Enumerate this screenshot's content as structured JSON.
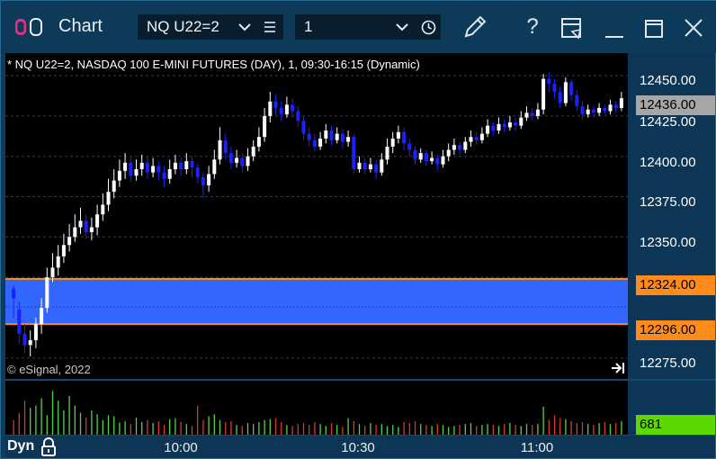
{
  "window": {
    "title": "Chart",
    "symbol_value": "NQ U22=2",
    "interval_value": "1",
    "icons": [
      "app-toggle-icon",
      "chevron-down-icon",
      "list-icon",
      "chevron-down-icon",
      "clock-icon",
      "pencil-icon",
      "help-icon",
      "form-icon",
      "minimize-icon",
      "maximize-icon",
      "close-icon"
    ],
    "help_label": "?"
  },
  "chart": {
    "title": "* NQ U22=2, NASDAQ 100 E-MINI FUTURES (DAY), 1, 09:30-16:15 (Dynamic)",
    "copyright": "© eSignal, 2022",
    "price_labels": [
      "12450.00",
      "12425.00",
      "12400.00",
      "12375.00",
      "12350.00",
      "12275.00"
    ],
    "current_price": "12436.00",
    "band_top_label": "12324.00",
    "band_bottom_label": "12296.00",
    "volume_label": "681",
    "time_labels": [
      "10:00",
      "10:30",
      "11:00"
    ],
    "dyn_label": "Dyn"
  },
  "chart_data": {
    "type": "candlestick",
    "ylim": [
      12262,
      12464
    ],
    "price_ticks": [
      12450,
      12425,
      12400,
      12375,
      12350,
      12325,
      12300,
      12275
    ],
    "current": 12436,
    "band": [
      12296,
      12324
    ],
    "x_ticks": [
      {
        "label": "10:00",
        "index": 33
      },
      {
        "label": "10:30",
        "index": 63
      },
      {
        "label": "11:00",
        "index": 93
      }
    ],
    "candles": [
      [
        12318,
        12312,
        12320,
        12300
      ],
      [
        12305,
        12290,
        12310,
        12284
      ],
      [
        12290,
        12283,
        12296,
        12278
      ],
      [
        12283,
        12286,
        12292,
        12276
      ],
      [
        12286,
        12296,
        12300,
        12281
      ],
      [
        12296,
        12306,
        12312,
        12290
      ],
      [
        12306,
        12325,
        12331,
        12303
      ],
      [
        12325,
        12331,
        12340,
        12322
      ],
      [
        12331,
        12338,
        12345,
        12326
      ],
      [
        12338,
        12345,
        12352,
        12334
      ],
      [
        12345,
        12350,
        12358,
        12341
      ],
      [
        12350,
        12356,
        12364,
        12347
      ],
      [
        12356,
        12360,
        12368,
        12352
      ],
      [
        12360,
        12353,
        12364,
        12349
      ],
      [
        12353,
        12356,
        12362,
        12348
      ],
      [
        12356,
        12364,
        12370,
        12351
      ],
      [
        12364,
        12370,
        12377,
        12360
      ],
      [
        12370,
        12378,
        12386,
        12366
      ],
      [
        12378,
        12385,
        12392,
        12374
      ],
      [
        12385,
        12391,
        12398,
        12381
      ],
      [
        12391,
        12396,
        12402,
        12386
      ],
      [
        12396,
        12388,
        12400,
        12384
      ],
      [
        12388,
        12392,
        12398,
        12385
      ],
      [
        12392,
        12396,
        12401,
        12388
      ],
      [
        12396,
        12390,
        12400,
        12386
      ],
      [
        12390,
        12394,
        12399,
        12387
      ],
      [
        12394,
        12390,
        12397,
        12385
      ],
      [
        12390,
        12386,
        12394,
        12381
      ],
      [
        12386,
        12392,
        12398,
        12383
      ],
      [
        12392,
        12396,
        12401,
        12389
      ],
      [
        12396,
        12392,
        12399,
        12388
      ],
      [
        12392,
        12397,
        12402,
        12389
      ],
      [
        12397,
        12393,
        12400,
        12387
      ],
      [
        12393,
        12387,
        12396,
        12383
      ],
      [
        12387,
        12382,
        12390,
        12374
      ],
      [
        12382,
        12389,
        12394,
        12378
      ],
      [
        12389,
        12398,
        12404,
        12386
      ],
      [
        12398,
        12410,
        12418,
        12395
      ],
      [
        12410,
        12402,
        12414,
        12398
      ],
      [
        12402,
        12396,
        12406,
        12392
      ],
      [
        12396,
        12399,
        12404,
        12393
      ],
      [
        12399,
        12394,
        12402,
        12390
      ],
      [
        12394,
        12400,
        12405,
        12391
      ],
      [
        12400,
        12406,
        12410,
        12397
      ],
      [
        12406,
        12412,
        12418,
        12403
      ],
      [
        12412,
        12425,
        12430,
        12409
      ],
      [
        12425,
        12434,
        12440,
        12421
      ],
      [
        12434,
        12430,
        12438,
        12426
      ],
      [
        12430,
        12426,
        12434,
        12422
      ],
      [
        12426,
        12432,
        12437,
        12424
      ],
      [
        12432,
        12428,
        12436,
        12424
      ],
      [
        12428,
        12422,
        12431,
        12418
      ],
      [
        12422,
        12414,
        12425,
        12410
      ],
      [
        12414,
        12410,
        12418,
        12406
      ],
      [
        12410,
        12406,
        12414,
        12403
      ],
      [
        12406,
        12411,
        12415,
        12404
      ],
      [
        12411,
        12416,
        12420,
        12408
      ],
      [
        12416,
        12410,
        12419,
        12407
      ],
      [
        12410,
        12414,
        12418,
        12408
      ],
      [
        12414,
        12409,
        12417,
        12405
      ],
      [
        12409,
        12412,
        12416,
        12406
      ],
      [
        12412,
        12392,
        12414,
        12389
      ],
      [
        12392,
        12396,
        12400,
        12390
      ],
      [
        12396,
        12392,
        12399,
        12389
      ],
      [
        12392,
        12395,
        12399,
        12390
      ],
      [
        12395,
        12390,
        12398,
        12386
      ],
      [
        12390,
        12398,
        12402,
        12388
      ],
      [
        12398,
        12406,
        12411,
        12395
      ],
      [
        12406,
        12411,
        12415,
        12402
      ],
      [
        12411,
        12415,
        12419,
        12408
      ],
      [
        12415,
        12408,
        12418,
        12404
      ],
      [
        12408,
        12404,
        12411,
        12400
      ],
      [
        12404,
        12398,
        12406,
        12395
      ],
      [
        12398,
        12402,
        12405,
        12396
      ],
      [
        12402,
        12397,
        12404,
        12394
      ],
      [
        12397,
        12399,
        12403,
        12395
      ],
      [
        12399,
        12395,
        12401,
        12391
      ],
      [
        12395,
        12400,
        12404,
        12393
      ],
      [
        12400,
        12404,
        12408,
        12397
      ],
      [
        12404,
        12407,
        12411,
        12401
      ],
      [
        12407,
        12404,
        12409,
        12401
      ],
      [
        12404,
        12409,
        12412,
        12402
      ],
      [
        12409,
        12412,
        12416,
        12406
      ],
      [
        12412,
        12410,
        12415,
        12407
      ],
      [
        12410,
        12414,
        12418,
        12408
      ],
      [
        12414,
        12419,
        12423,
        12412
      ],
      [
        12419,
        12416,
        12421,
        12413
      ],
      [
        12416,
        12420,
        12424,
        12414
      ],
      [
        12420,
        12418,
        12423,
        12415
      ],
      [
        12418,
        12421,
        12425,
        12416
      ],
      [
        12421,
        12419,
        12424,
        12416
      ],
      [
        12419,
        12424,
        12428,
        12417
      ],
      [
        12424,
        12427,
        12431,
        12422
      ],
      [
        12427,
        12425,
        12430,
        12422
      ],
      [
        12425,
        12429,
        12433,
        12423
      ],
      [
        12429,
        12448,
        12451,
        12426
      ],
      [
        12448,
        12445,
        12452,
        12440
      ],
      [
        12445,
        12440,
        12448,
        12436
      ],
      [
        12440,
        12433,
        12443,
        12430
      ],
      [
        12433,
        12446,
        12449,
        12431
      ],
      [
        12446,
        12438,
        12448,
        12434
      ],
      [
        12438,
        12431,
        12441,
        12428
      ],
      [
        12431,
        12426,
        12434,
        12423
      ],
      [
        12426,
        12429,
        12432,
        12424
      ],
      [
        12429,
        12427,
        12431,
        12424
      ],
      [
        12427,
        12430,
        12433,
        12425
      ],
      [
        12430,
        12428,
        12432,
        12426
      ],
      [
        12428,
        12432,
        12435,
        12426
      ],
      [
        12432,
        12430,
        12434,
        12427
      ],
      [
        12430,
        12436,
        12440,
        12428
      ]
    ],
    "volume": {
      "max": 100,
      "values": [
        30,
        45,
        70,
        55,
        60,
        75,
        40,
        90,
        70,
        50,
        80,
        60,
        45,
        35,
        50,
        42,
        30,
        40,
        38,
        25,
        28,
        22,
        35,
        26,
        30,
        24,
        28,
        20,
        32,
        34,
        26,
        22,
        18,
        60,
        30,
        38,
        42,
        30,
        26,
        28,
        20,
        18,
        24,
        22,
        26,
        30,
        32,
        34,
        26,
        20,
        18,
        22,
        24,
        20,
        26,
        22,
        18,
        24,
        20,
        16,
        34,
        28,
        22,
        18,
        24,
        20,
        22,
        18,
        20,
        16,
        26,
        24,
        28,
        22,
        20,
        18,
        22,
        20,
        16,
        18,
        20,
        22,
        24,
        18,
        20,
        22,
        20,
        18,
        22,
        24,
        20,
        18,
        22,
        20,
        22,
        58,
        30,
        40,
        34,
        32,
        28,
        24,
        26,
        22,
        20,
        24,
        26,
        22,
        24,
        28,
        34
      ]
    },
    "colors": {
      "up": "#ffffff",
      "down": "#1a22ff",
      "band": "#3366ff",
      "band_edge": "#ff8c1a",
      "current_bg": "#a6a6a6",
      "vol_up": "#52d44a",
      "vol_down": "#d63a2e",
      "vol_label_bg": "#5bd900",
      "band_label_bg": "#ff8c1a"
    }
  }
}
